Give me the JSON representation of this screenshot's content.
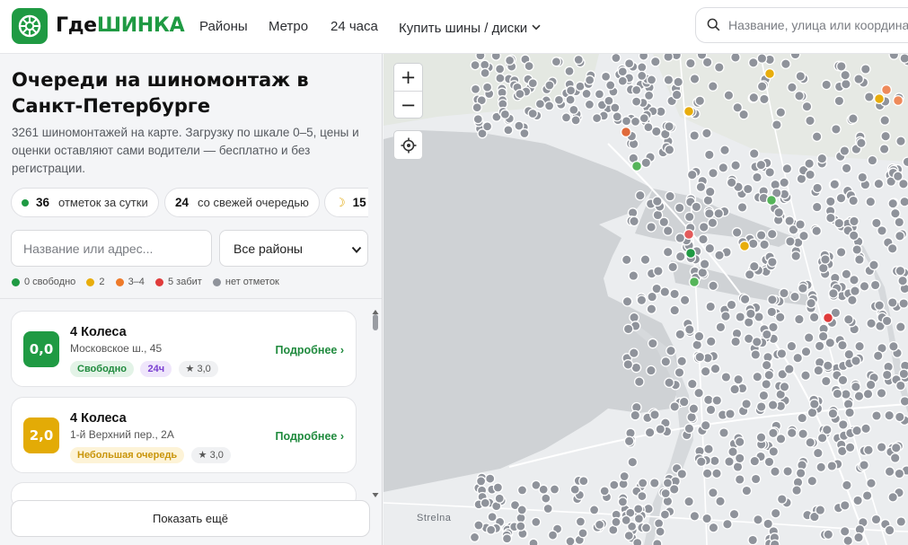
{
  "header": {
    "logo_part1": "Где",
    "logo_part2": "ШИНКА",
    "nav": [
      "Районы",
      "Метро",
      "24 часа",
      "Купить шины / диски"
    ],
    "search_placeholder": "Название, улица или координаты"
  },
  "sidebar": {
    "title": "Очереди на шиномонтаж в Санкт-Петербурге",
    "description": "3261 шиномонтажей на карте. Загрузку по шкале 0–5, цены и оценки оставляют сами водители — бесплатно и без регистрации.",
    "stats": [
      {
        "value": "36",
        "label": "отметок за сутки",
        "icon": "green-dot"
      },
      {
        "value": "24",
        "label": "со свежей очередью",
        "icon": ""
      },
      {
        "value": "15",
        "label": "",
        "icon": "moon-icon"
      }
    ],
    "filter_placeholder": "Название или адрес...",
    "district_value": "Все районы",
    "legend": [
      {
        "label": "0 свободно",
        "color": "#1f9a43"
      },
      {
        "label": "2",
        "color": "#e8ad0c"
      },
      {
        "label": "3–4",
        "color": "#ee7a2a"
      },
      {
        "label": "5 забит",
        "color": "#e03b3b"
      },
      {
        "label": "нет отметок",
        "color": "#8f939b"
      }
    ],
    "cards": [
      {
        "score": "0,0",
        "score_color": "#1f9a43",
        "name": "4 Колеса",
        "address": "Московское ш., 45",
        "status": "Свободно",
        "hours": "24ч",
        "rating": "★ 3,0",
        "more": "Подробнее ›"
      },
      {
        "score": "2,0",
        "score_color": "#e3ab06",
        "name": "4 Колеса",
        "address": "1-й Верхний пер., 2А",
        "status": "Небольшая очередь",
        "rating": "★ 3,0",
        "more": "Подробнее ›"
      }
    ],
    "show_more": "Показать ещё"
  },
  "map": {
    "zoom_in": "+",
    "zoom_out": "−",
    "label": "Strelna"
  }
}
